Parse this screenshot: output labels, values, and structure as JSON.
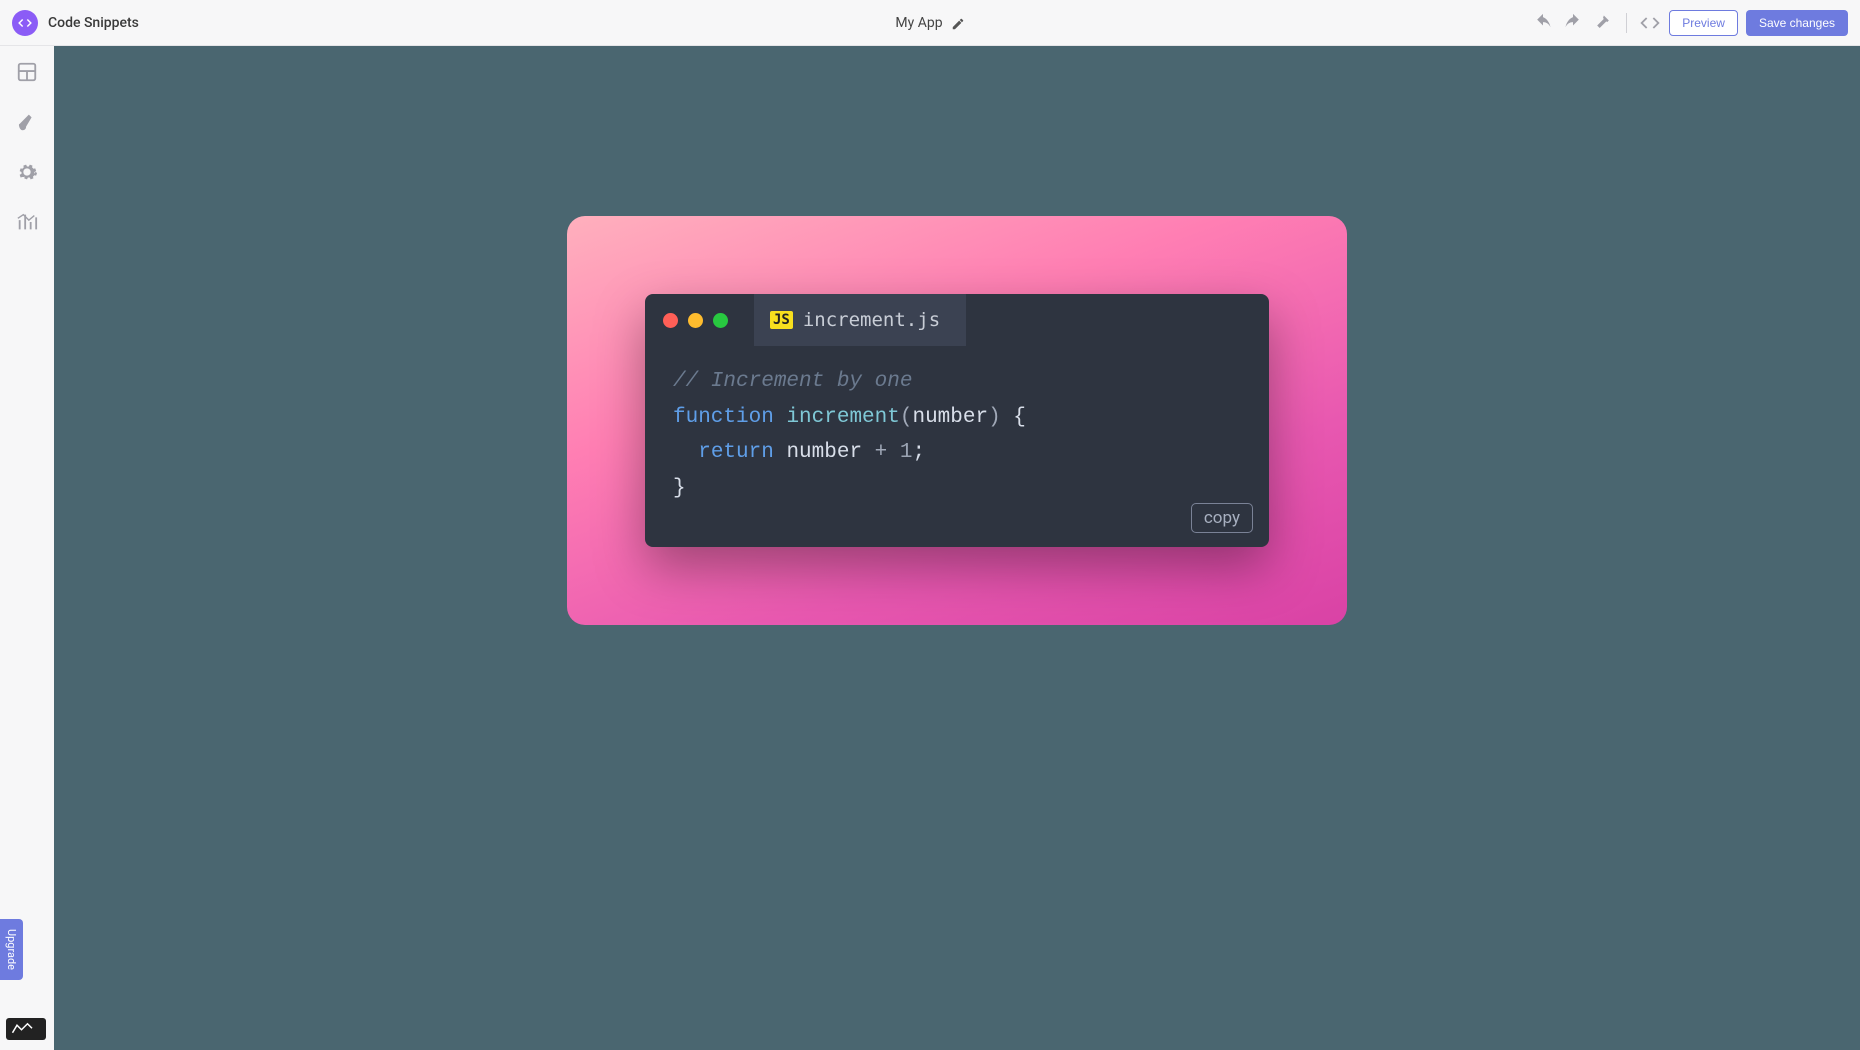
{
  "header": {
    "page_title": "Code Snippets",
    "app_name": "My App",
    "preview_label": "Preview",
    "save_label": "Save changes"
  },
  "sidebar": {
    "upgrade_label": "Upgrade"
  },
  "snippet": {
    "filename": "increment.js",
    "js_badge": "JS",
    "copy_label": "copy",
    "code": {
      "line1_comment": "// Increment by one",
      "line2_kw_function": "function",
      "line2_func_name": "increment",
      "line2_open_paren": "(",
      "line2_param": "number",
      "line2_close_paren": ")",
      "line2_brace": " {",
      "line3_indent": "  ",
      "line3_kw_return": "return",
      "line3_expr_a": " number ",
      "line3_op": "+",
      "line3_space": " ",
      "line3_num": "1",
      "line3_semi": ";",
      "line4_close": "}"
    }
  },
  "colors": {
    "traffic_red": "#ff5f57",
    "traffic_yellow": "#febc2e",
    "traffic_green": "#28c840"
  }
}
